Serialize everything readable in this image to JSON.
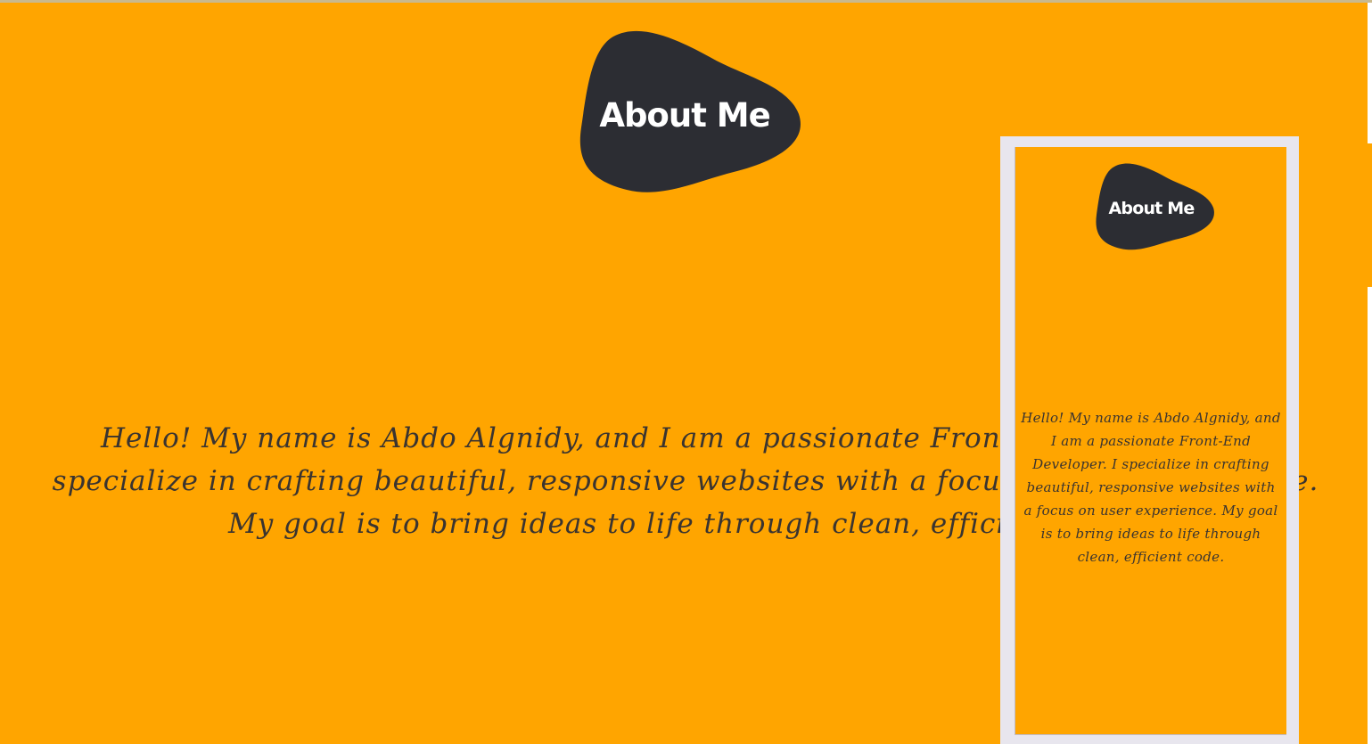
{
  "colors": {
    "background": "#FFA500",
    "blob": "#2C2D33",
    "heading_text": "#FFFFFF",
    "body_text": "#3A3430",
    "device_frame": "#E8E6EE"
  },
  "about": {
    "title": "About Me",
    "description": "Hello! My name is Abdo Algnidy, and I am a passionate Front-End Developer. I specialize in crafting beautiful, responsive websites with a focus on user experience. My goal is to bring ideas to life through clean, efficient code."
  },
  "mobile_preview": {
    "title": "About Me",
    "description": "Hello! My name is Abdo Algnidy, and I am a passionate Front-End Developer. I specialize in crafting beautiful, responsive websites with a focus on user experience. My goal is to bring ideas to life through clean, efficient code."
  }
}
